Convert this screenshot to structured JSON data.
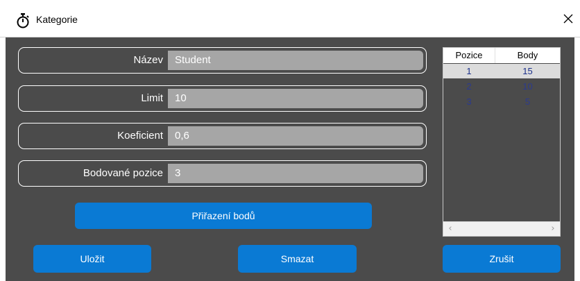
{
  "window": {
    "title": "Kategorie",
    "icon": "stopwatch-icon",
    "close_glyph": "✕"
  },
  "form": {
    "fields": [
      {
        "label": "Název",
        "value": "Student"
      },
      {
        "label": "Limit",
        "value": "10"
      },
      {
        "label": "Koeficient",
        "value": "0,6"
      },
      {
        "label": "Bodované pozice",
        "value": "3"
      }
    ],
    "assign_button": "Přiřazení bodů"
  },
  "points_table": {
    "columns": [
      "Pozice",
      "Body"
    ],
    "rows": [
      {
        "position": "1",
        "points": "15",
        "selected": true
      },
      {
        "position": "2",
        "points": "10",
        "selected": false
      },
      {
        "position": "3",
        "points": "5",
        "selected": false
      }
    ],
    "scroll_left_glyph": "‹",
    "scroll_right_glyph": "›"
  },
  "footer": {
    "save_label": "Uložit",
    "delete_label": "Smazat",
    "cancel_label": "Zrušit"
  },
  "colors": {
    "background": "#4b4b4b",
    "field_fill": "#a6a6a6",
    "accent": "#0a7ad4",
    "row_selected": "#dcdcdc",
    "row_text": "#2b3a8e"
  }
}
